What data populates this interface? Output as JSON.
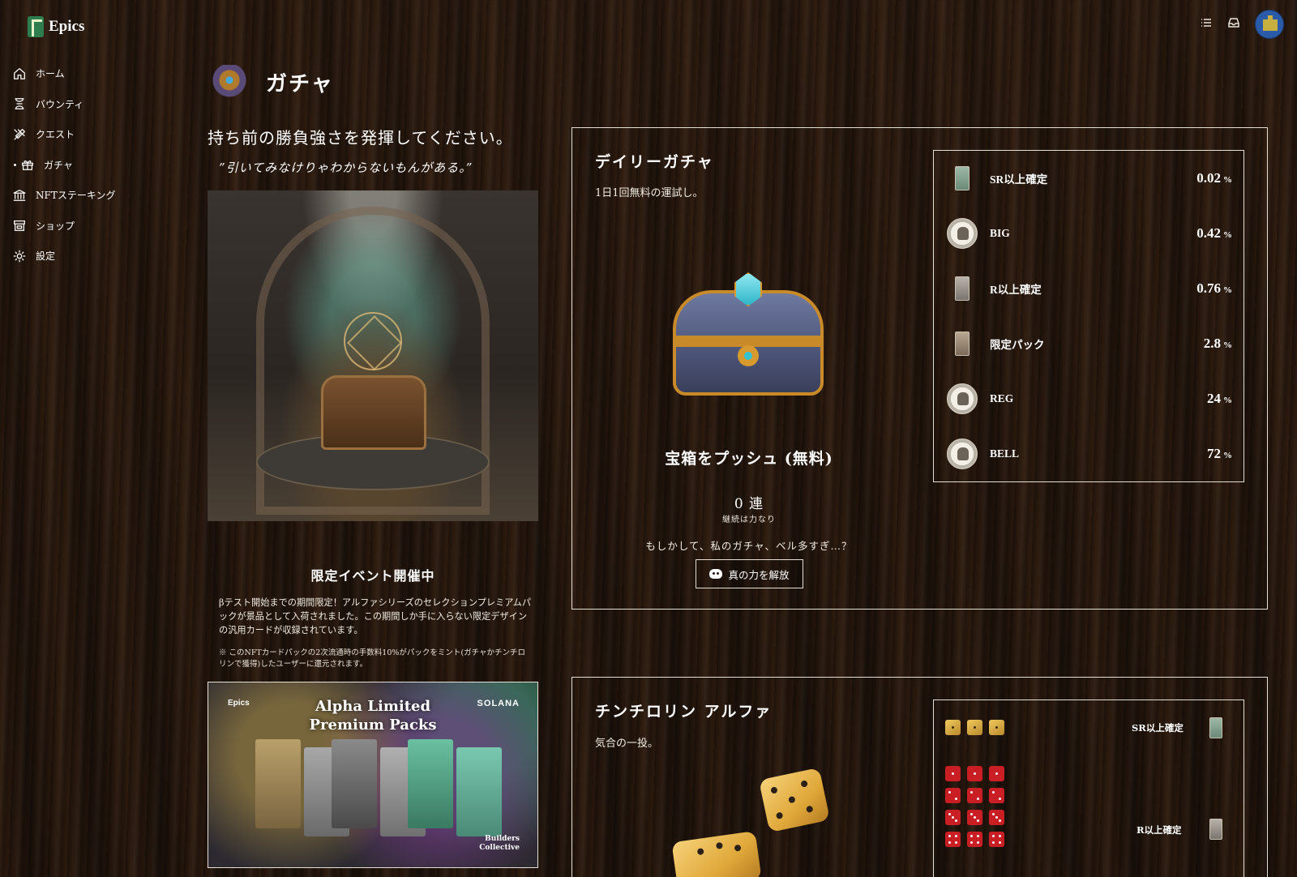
{
  "app": {
    "name": "Epics"
  },
  "sidebar": {
    "items": [
      {
        "label": "ホーム",
        "icon": "home-icon"
      },
      {
        "label": "バウンティ",
        "icon": "hourglass-icon"
      },
      {
        "label": "クエスト",
        "icon": "tools-icon"
      },
      {
        "label": "ガチャ",
        "icon": "gift-icon",
        "active": true
      },
      {
        "label": "NFTステーキング",
        "icon": "bank-icon"
      },
      {
        "label": "ショップ",
        "icon": "shop-icon"
      },
      {
        "label": "設定",
        "icon": "gear-icon"
      }
    ]
  },
  "topbar": {
    "icons": [
      "list-icon",
      "inbox-icon",
      "avatar"
    ]
  },
  "page": {
    "title": "ガチャ",
    "tagline": "持ち前の勝負強さを発揮してください。",
    "quote": "”引いてみなけりゃわからないもんがある。”"
  },
  "event": {
    "title": "限定イベント開催中",
    "body": "βテスト開始までの期間限定！アルファシリーズのセレクションプレミアムパックが景品として入荷されました。この期間しか手に入らない限定デザインの汎用カードが収録されています。",
    "note": "※ このNFTカードパックの2次流通時の手数料10%がパックをミント(ガチャかチンチロリンで獲得)したユーザーに還元されます。",
    "banner": {
      "brand": "Epics",
      "title_line1": "Alpha Limited",
      "title_line2": "Premium Packs",
      "partner": "SOLANA",
      "collective_line1": "Builders",
      "collective_line2": "Collective"
    }
  },
  "daily": {
    "title": "デイリーガチャ",
    "subtitle": "1日1回無料の運試し。",
    "push_label": "宝箱をプッシュ (無料)",
    "streak": "0 連",
    "streak_sub": "継続は力なり",
    "note": "もしかして、私のガチャ、ベル多すぎ…？",
    "unlock_label": "真の力を解放",
    "odds": [
      {
        "label": "SR以上確定",
        "value": "0.02",
        "unit": "%",
        "icon": "card-pack-icon"
      },
      {
        "label": "BIG",
        "value": "0.42",
        "unit": "%",
        "icon": "coin-icon"
      },
      {
        "label": "R以上確定",
        "value": "0.76",
        "unit": "%",
        "icon": "card-pack-icon"
      },
      {
        "label": "限定パック",
        "value": "2.8",
        "unit": "%",
        "icon": "card-pack-icon"
      },
      {
        "label": "REG",
        "value": "24",
        "unit": "%",
        "icon": "coin-icon"
      },
      {
        "label": "BELL",
        "value": "72",
        "unit": "%",
        "icon": "coin-icon"
      }
    ]
  },
  "chinchiro": {
    "title": "チンチロリン アルファ",
    "subtitle": "気合の一投。",
    "rewards": [
      {
        "label": "SR以上確定"
      },
      {
        "label": "R以上確定"
      }
    ]
  }
}
